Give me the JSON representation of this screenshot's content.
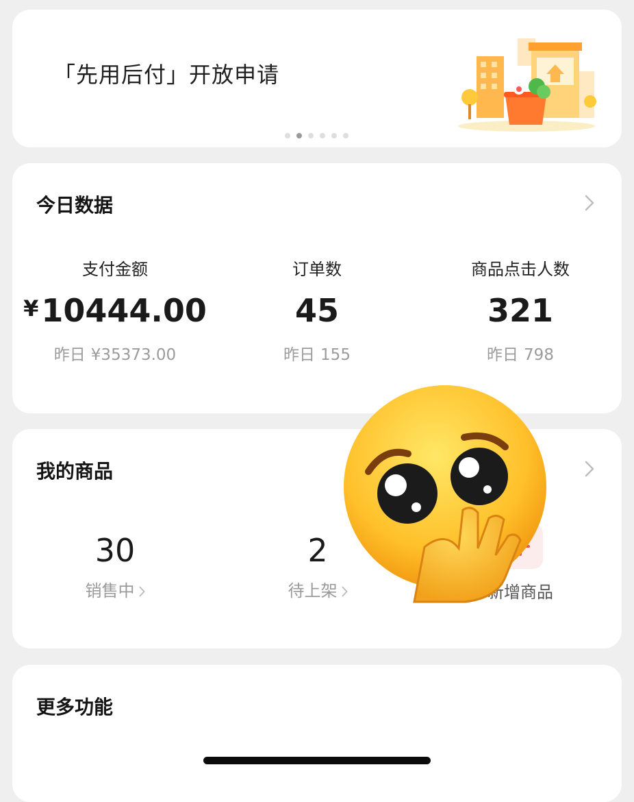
{
  "banner": {
    "headline": "「先用后付」开放申请",
    "dots": [
      false,
      true,
      false,
      false,
      false,
      false
    ]
  },
  "today": {
    "title": "今日数据",
    "stats": [
      {
        "label": "支付金额",
        "currency": "¥",
        "value": "10444.00",
        "yesterday_label": "昨日",
        "yesterday_value": "¥35373.00"
      },
      {
        "label": "订单数",
        "currency": "",
        "value": "45",
        "yesterday_label": "昨日",
        "yesterday_value": "155"
      },
      {
        "label": "商品点击人数",
        "currency": "",
        "value": "321",
        "yesterday_label": "昨日",
        "yesterday_value": "798"
      }
    ]
  },
  "products": {
    "title": "我的商品",
    "on_sale": {
      "count": "30",
      "label": "销售中"
    },
    "pending": {
      "count": "2",
      "label": "待上架"
    },
    "add": {
      "label": "新增商品"
    }
  },
  "more": {
    "title": "更多功能"
  },
  "colors": {
    "background": "#efefef",
    "card": "#ffffff",
    "accent_red": "#e8584f",
    "muted_text": "#9b9b9b"
  },
  "icons": [
    "chevron-right-icon",
    "plus-icon",
    "emoji-face-sticker"
  ]
}
